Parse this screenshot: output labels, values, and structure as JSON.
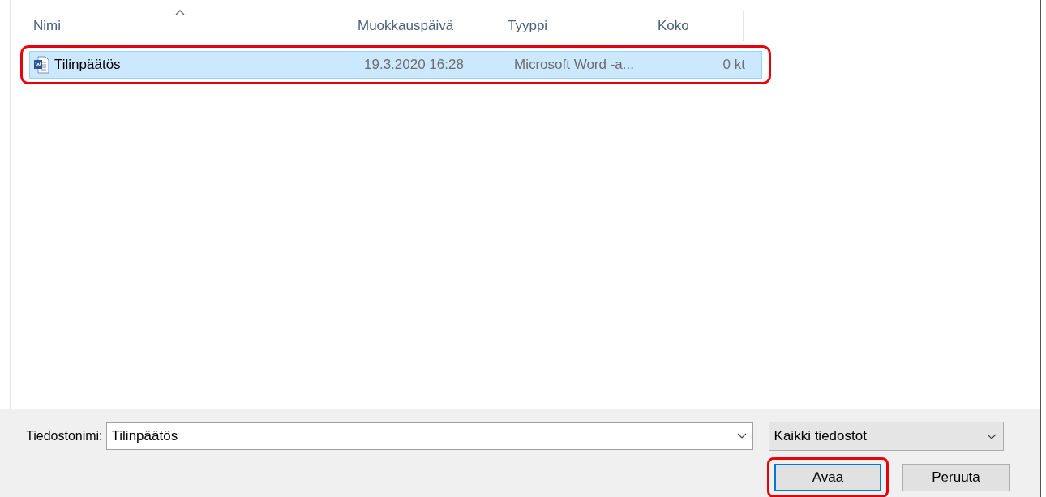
{
  "file_list": {
    "columns": [
      {
        "label": "Nimi",
        "sorted": true
      },
      {
        "label": "Muokkauspäivä",
        "sorted": false
      },
      {
        "label": "Tyyppi",
        "sorted": false
      },
      {
        "label": "Koko",
        "sorted": false
      }
    ],
    "rows": [
      {
        "name": "Tilinpäätös",
        "modified": "19.3.2020 16:28",
        "type": "Microsoft Word -a...",
        "size": "0 kt",
        "selected": true,
        "highlighted": true
      }
    ]
  },
  "footer": {
    "filename_label": "Tiedostonimi:",
    "filename": {
      "value": "Tilinpäätös"
    },
    "filetype": {
      "value": "Kaikki tiedostot"
    },
    "buttons": [
      {
        "label": "Avaa",
        "default": true,
        "highlighted": true
      },
      {
        "label": "Peruuta",
        "default": false,
        "highlighted": false
      }
    ]
  }
}
